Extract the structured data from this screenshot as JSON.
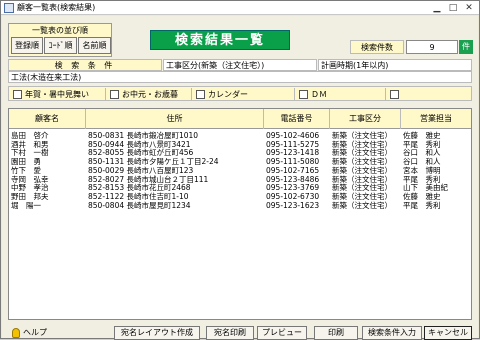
{
  "window": {
    "title": "顧客一覧表(検索結果)"
  },
  "sort": {
    "label": "一覧表の並び順",
    "buttons": [
      "登録順",
      "ｺｰﾄﾞ順",
      "名前順"
    ]
  },
  "banner": "検索結果一覧",
  "count": {
    "label": "検索件数",
    "value": "9",
    "unit": "件"
  },
  "conditions": {
    "header": "検 索 条 件",
    "construction": "工事区分(新築（注文住宅）)",
    "plan": "計画時期(1年以内)",
    "method": "工法(木造在来工法)"
  },
  "checks": [
    "年賀・暑中見舞い",
    "お中元・お歳暮",
    "カレンダー",
    "ＤＭ"
  ],
  "table": {
    "columns": [
      "顧客名",
      "住所",
      "電話番号",
      "工事区分",
      "営業担当"
    ],
    "rows": [
      [
        "島田　啓介",
        "850-0831 長崎市鍛冶屋町1010",
        "095-102-4606",
        "新築（注文住宅）",
        "佐藤　雅史"
      ],
      [
        "酒井　和男",
        "850-0944 長崎市八景町3421",
        "095-111-5275",
        "新築（注文住宅）",
        "平尾　秀利"
      ],
      [
        "下村　一樹",
        "852-8055 長崎市虹が丘町456",
        "095-123-1418",
        "新築（注文住宅）",
        "谷口　和人"
      ],
      [
        "園田　勇",
        "850-1131 長崎市夕陽ケ丘１丁目2-24",
        "095-111-5080",
        "新築（注文住宅）",
        "谷口　和人"
      ],
      [
        "竹下　愛",
        "850-0029 長崎市八百屋町123",
        "095-102-7165",
        "新築（注文住宅）",
        "宮本　博明"
      ],
      [
        "寺岡　弘幸",
        "852-8027 長崎市城山台２丁目111",
        "095-123-8486",
        "新築（注文住宅）",
        "平尾　秀利"
      ],
      [
        "中野　孝治",
        "852-8153 長崎市花丘町2468",
        "095-123-3769",
        "新築（注文住宅）",
        "山下　美由紀"
      ],
      [
        "野田　邦夫",
        "852-1122 長崎市住吉町1-10",
        "095-102-6730",
        "新築（注文住宅）",
        "佐藤　雅史"
      ],
      [
        "堀　陽一",
        "850-0804 長崎市屋見町1234",
        "095-123-1623",
        "新築（注文住宅）",
        "平尾　秀利"
      ]
    ]
  },
  "footer": {
    "help": "ヘルプ",
    "buttons": [
      "宛名レイアウト作成",
      "宛名印刷",
      "プレビュー",
      "印刷",
      "検索条件入力",
      "キャンセル"
    ]
  }
}
